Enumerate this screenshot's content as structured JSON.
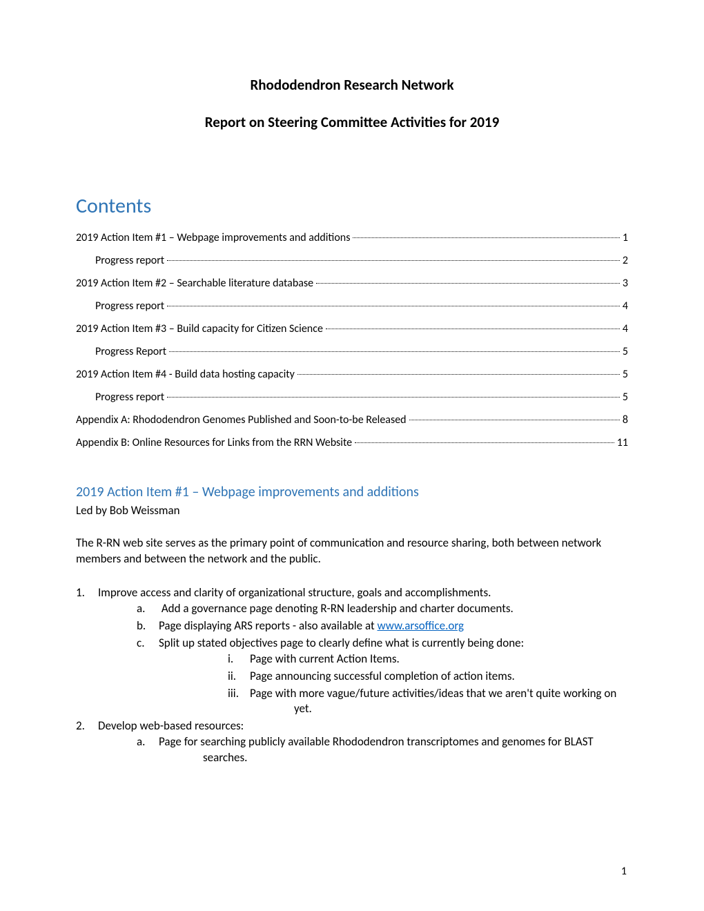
{
  "header": {
    "title": "Rhododendron Research Network",
    "subtitle": "Report on Steering Committee Activities for 2019"
  },
  "contents_heading": "Contents",
  "toc": [
    {
      "text": "2019 Action Item #1 – Webpage improvements and additions",
      "page": "1",
      "indent": false
    },
    {
      "text": "Progress report",
      "page": "2",
      "indent": true
    },
    {
      "text": "2019 Action Item #2 – Searchable literature database",
      "page": "3",
      "indent": false
    },
    {
      "text": "Progress report",
      "page": "4",
      "indent": true
    },
    {
      "text": "2019 Action Item #3 – Build capacity for Citizen Science",
      "page": "4",
      "indent": false
    },
    {
      "text": "Progress Report",
      "page": "5",
      "indent": true
    },
    {
      "text": "2019 Action Item #4 - Build data hosting capacity",
      "page": "5",
      "indent": false
    },
    {
      "text": "Progress report",
      "page": "5",
      "indent": true
    },
    {
      "text": "Appendix A: Rhododendron Genomes Published and Soon-to-be Released",
      "page": "8",
      "indent": false
    },
    {
      "text": "Appendix B: Online Resources for Links from the RRN Website",
      "page": "11",
      "indent": false
    }
  ],
  "section1": {
    "heading": "2019 Action Item #1 – Webpage improvements and additions",
    "byline": "Led by Bob Weissman",
    "intro": "The R-RN web site serves as the primary point of communication and resource sharing, both between network members and between the network and the public.",
    "l1_1_num": "1.",
    "l1_1_text": "Improve access and clarity of organizational structure, goals and accomplishments.",
    "l1_1a_marker": "a.",
    "l1_1a_text": " Add a governance page denoting R-RN leadership and charter documents.",
    "l1_1b_marker": "b.",
    "l1_1b_pre": "Page displaying ARS reports - also available at ",
    "l1_1b_link": "www.arsoffice.org",
    "l1_1c_marker": "c.",
    "l1_1c_text": "Split up stated objectives page to clearly define what is currently being done:",
    "l1_1c_i_marker": "i.",
    "l1_1c_i_text": "Page with current Action Items.",
    "l1_1c_ii_marker": "ii.",
    "l1_1c_ii_text": "Page announcing successful completion of action items.",
    "l1_1c_iii_marker": "iii.",
    "l1_1c_iii_text": "Page with more vague/future activities/ideas that we aren't quite working on yet.",
    "l1_2_num": "2.",
    "l1_2_text": "Develop web-based resources:",
    "l1_2a_marker": "a.",
    "l1_2a_text": "Page for searching publicly available Rhododendron transcriptomes and genomes for BLAST searches."
  },
  "page_number": "1"
}
